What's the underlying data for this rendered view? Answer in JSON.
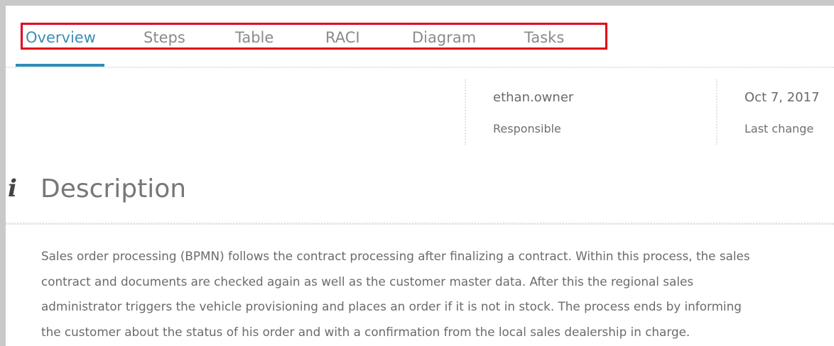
{
  "tabs": {
    "items": [
      {
        "label": "Overview",
        "active": true
      },
      {
        "label": "Steps",
        "active": false
      },
      {
        "label": "Table",
        "active": false
      },
      {
        "label": "RACI",
        "active": false
      },
      {
        "label": "Diagram",
        "active": false
      },
      {
        "label": "Tasks",
        "active": false
      }
    ],
    "highlight_color": "#e0001b",
    "active_color": "#2e8cb8"
  },
  "meta": {
    "owner": {
      "value": "ethan.owner",
      "label": "Responsible"
    },
    "last_change": {
      "value": "Oct 7, 2017",
      "label": "Last change"
    }
  },
  "description": {
    "icon": "info-icon",
    "heading": "Description",
    "text": "Sales order processing (BPMN) follows the contract processing after finalizing a contract. Within this process, the sales\ncontract and documents are checked again as well as the customer master data. After this the regional sales\nadministrator triggers the vehicle provisioning and places an order if it is not in stock. The process ends by informing\nthe customer about the status of his order and with a confirmation from the local sales dealership in charge."
  }
}
